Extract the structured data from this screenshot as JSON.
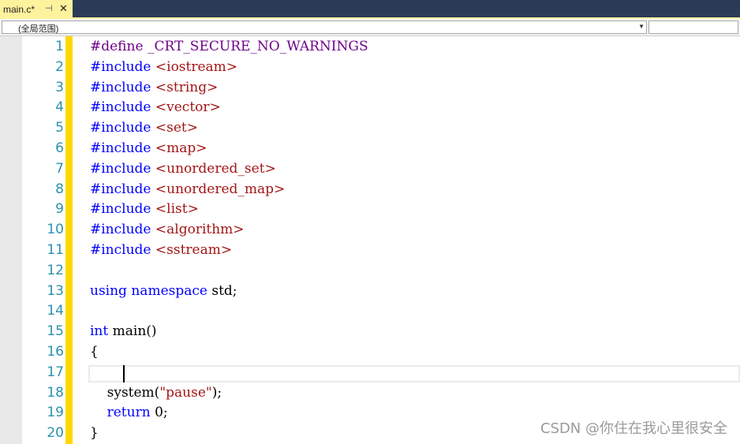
{
  "tab": {
    "title": "main.c*",
    "pin_icon": "pin-icon",
    "close_icon": "close-icon",
    "pin_glyph": "⊣",
    "close_glyph": "✕"
  },
  "navbar": {
    "scope": "(全局范围)",
    "member": ""
  },
  "line_numbers": [
    "1",
    "2",
    "3",
    "4",
    "5",
    "6",
    "7",
    "8",
    "9",
    "10",
    "11",
    "12",
    "13",
    "14",
    "15",
    "16",
    "17",
    "18",
    "19",
    "20"
  ],
  "code_lines": [
    [
      {
        "t": "#define",
        "c": "ppkw"
      },
      {
        "t": " _CRT_SECURE_NO_WARNINGS",
        "c": "ppkw"
      }
    ],
    [
      {
        "t": "#include ",
        "c": "kw"
      },
      {
        "t": "<iostream>",
        "c": "str"
      }
    ],
    [
      {
        "t": "#include ",
        "c": "kw"
      },
      {
        "t": "<string>",
        "c": "str"
      }
    ],
    [
      {
        "t": "#include ",
        "c": "kw"
      },
      {
        "t": "<vector>",
        "c": "str"
      }
    ],
    [
      {
        "t": "#include ",
        "c": "kw"
      },
      {
        "t": "<set>",
        "c": "str"
      }
    ],
    [
      {
        "t": "#include ",
        "c": "kw"
      },
      {
        "t": "<map>",
        "c": "str"
      }
    ],
    [
      {
        "t": "#include ",
        "c": "kw"
      },
      {
        "t": "<unordered_set>",
        "c": "str"
      }
    ],
    [
      {
        "t": "#include ",
        "c": "kw"
      },
      {
        "t": "<unordered_map>",
        "c": "str"
      }
    ],
    [
      {
        "t": "#include ",
        "c": "kw"
      },
      {
        "t": "<list>",
        "c": "str"
      }
    ],
    [
      {
        "t": "#include ",
        "c": "kw"
      },
      {
        "t": "<algorithm>",
        "c": "str"
      }
    ],
    [
      {
        "t": "#include ",
        "c": "kw"
      },
      {
        "t": "<sstream>",
        "c": "str"
      }
    ],
    [],
    [
      {
        "t": "using ",
        "c": "kw"
      },
      {
        "t": "namespace ",
        "c": "kw"
      },
      {
        "t": "std;",
        "c": ""
      }
    ],
    [],
    [
      {
        "t": "int ",
        "c": "kw"
      },
      {
        "t": "main()",
        "c": ""
      }
    ],
    [
      {
        "t": "{",
        "c": ""
      }
    ],
    [
      {
        "t": "    ",
        "c": ""
      }
    ],
    [
      {
        "t": "    system(",
        "c": ""
      },
      {
        "t": "\"pause\"",
        "c": "str"
      },
      {
        "t": ");",
        "c": ""
      }
    ],
    [
      {
        "t": "    ",
        "c": ""
      },
      {
        "t": "return ",
        "c": "kw"
      },
      {
        "t": "0;",
        "c": ""
      }
    ],
    [
      {
        "t": "}",
        "c": ""
      }
    ]
  ],
  "current_line_index": 16,
  "watermark": "CSDN @你住在我心里很安全",
  "colors": {
    "keyword": "#0000ff",
    "string": "#a31515",
    "line_number": "#2b91af",
    "change_bar": "#ffd700",
    "tab_active": "#fff29d",
    "tab_strip": "#2b3a55"
  }
}
